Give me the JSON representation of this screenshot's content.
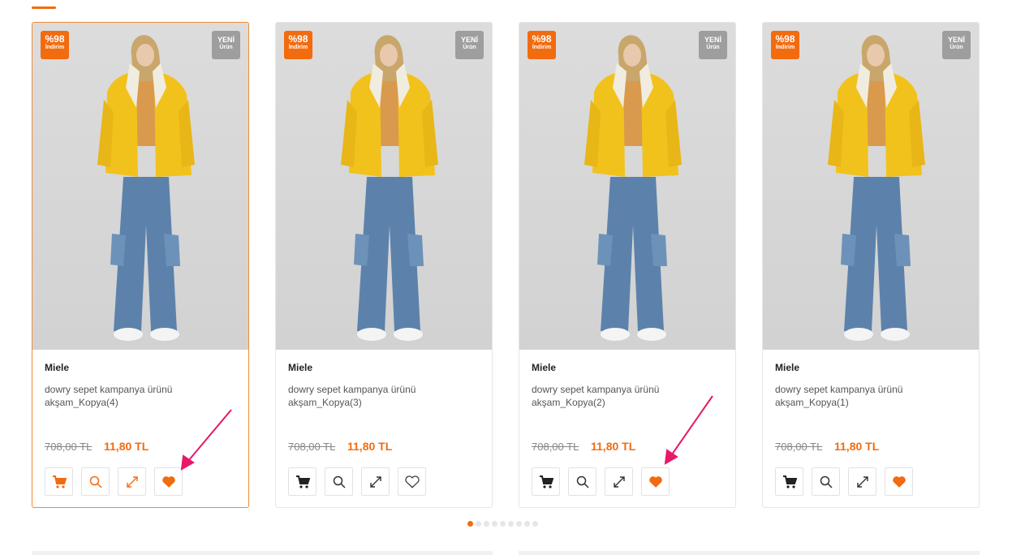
{
  "colors": {
    "accent": "#f26b0f",
    "new_badge": "#9e9e9e",
    "annotation_arrow": "#e8186a"
  },
  "products": [
    {
      "brand": "Miele",
      "name": "dowry sepet kampanya ürünü akşam_Kopya(4)",
      "old_price": "708,00 TL",
      "new_price": "11,80 TL",
      "discount": "%98",
      "discount_label": "İndirim",
      "new_line1": "YENİ",
      "new_line2": "Ürün",
      "favorited": true
    },
    {
      "brand": "Miele",
      "name": "dowry sepet kampanya ürünü akşam_Kopya(3)",
      "old_price": "708,00 TL",
      "new_price": "11,80 TL",
      "discount": "%98",
      "discount_label": "İndirim",
      "new_line1": "YENİ",
      "new_line2": "Ürün",
      "favorited": false
    },
    {
      "brand": "Miele",
      "name": "dowry sepet kampanya ürünü akşam_Kopya(2)",
      "old_price": "708,00 TL",
      "new_price": "11,80 TL",
      "discount": "%98",
      "discount_label": "İndirim",
      "new_line1": "YENİ",
      "new_line2": "Ürün",
      "favorited": true
    },
    {
      "brand": "Miele",
      "name": "dowry sepet kampanya ürünü akşam_Kopya(1)",
      "old_price": "708,00 TL",
      "new_price": "11,80 TL",
      "discount": "%98",
      "discount_label": "İndirim",
      "new_line1": "YENİ",
      "new_line2": "Ürün",
      "favorited": true
    }
  ],
  "icons": {
    "cart": "cart-icon",
    "search": "search-icon",
    "compare": "compare-icon",
    "favorite": "heart-icon"
  },
  "carousel": {
    "pages": 9,
    "active_page": 1
  }
}
